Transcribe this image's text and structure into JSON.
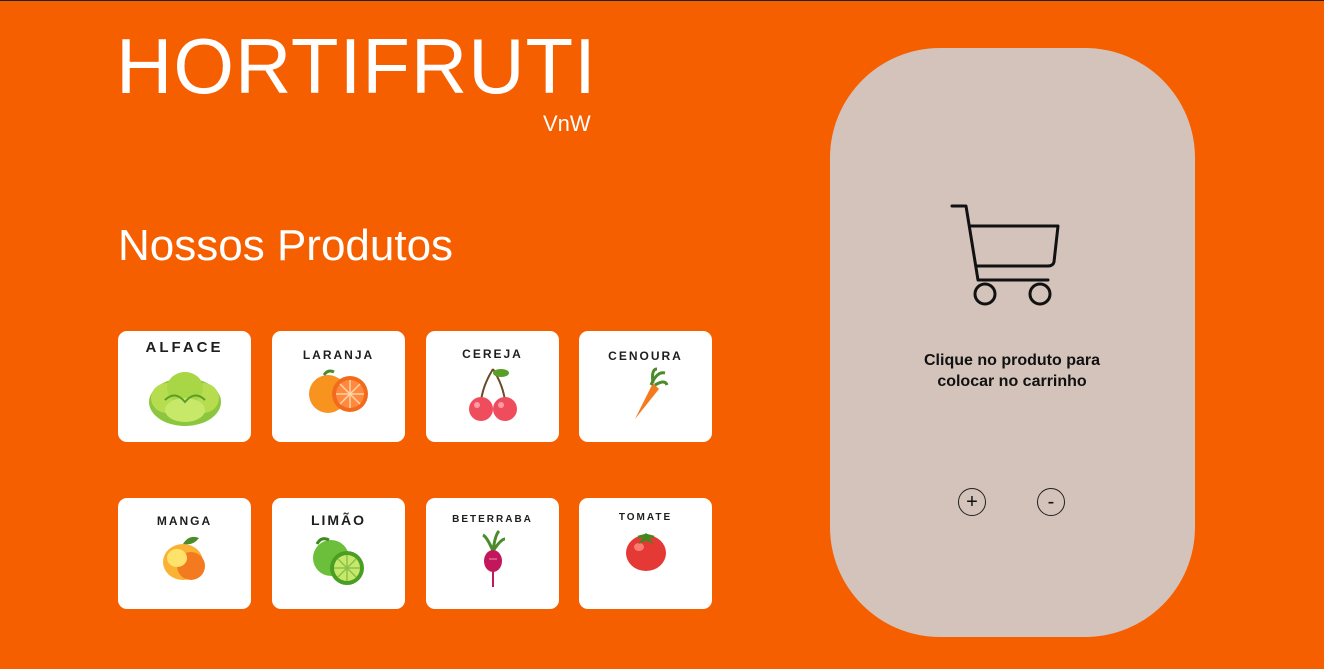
{
  "header": {
    "title": "HORTIFRUTI",
    "subtitle": "VnW"
  },
  "products_section": {
    "title": "Nossos Produtos",
    "products": [
      {
        "label": "ALFACE",
        "icon": "lettuce-icon"
      },
      {
        "label": "LARANJA",
        "icon": "orange-icon"
      },
      {
        "label": "CEREJA",
        "icon": "cherry-icon"
      },
      {
        "label": "CENOURA",
        "icon": "carrot-icon"
      },
      {
        "label": "MANGA",
        "icon": "mango-icon"
      },
      {
        "label": "LIMÃO",
        "icon": "lime-icon"
      },
      {
        "label": "BETERRABA",
        "icon": "beet-icon"
      },
      {
        "label": "TOMATE",
        "icon": "tomato-icon"
      }
    ]
  },
  "cart": {
    "icon": "cart-icon",
    "message": "Clique no produto para colocar no carrinho",
    "plus_label": "+",
    "minus_label": "-"
  },
  "colors": {
    "background": "#f65f00",
    "panel": "#d3c3ba",
    "card": "#ffffff"
  }
}
